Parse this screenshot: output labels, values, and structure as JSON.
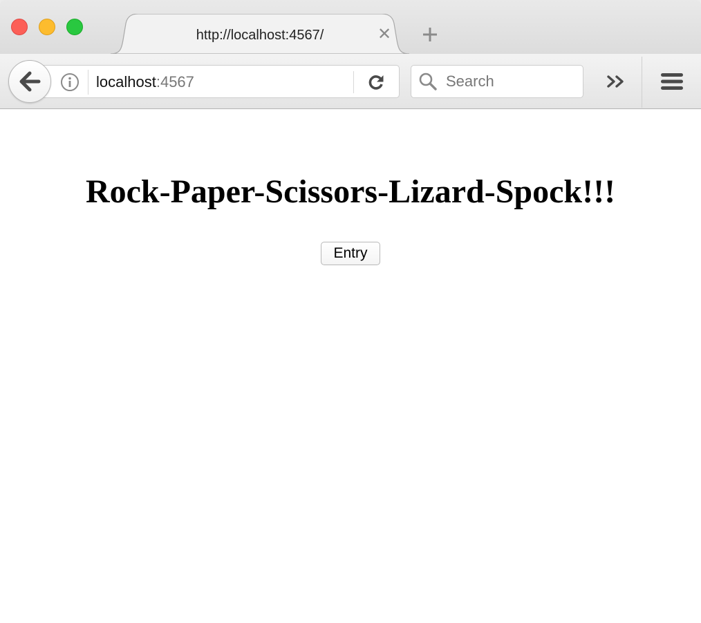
{
  "browser": {
    "tab": {
      "title": "http://localhost:4567/",
      "close_glyph": "✕"
    },
    "address_bar": {
      "host": "localhost",
      "port": ":4567"
    },
    "search": {
      "placeholder": "Search"
    },
    "icons": [
      "back-arrow-icon",
      "info-icon",
      "reload-icon",
      "search-icon",
      "overflow-chevrons-icon",
      "hamburger-menu-icon",
      "new-tab-plus-icon"
    ],
    "traffic_lights": {
      "close": "#fc5f57",
      "minimize": "#fdbc2e",
      "maximize": "#29c840"
    }
  },
  "page": {
    "heading": "Rock-Paper-Scissors-Lizard-Spock!!!",
    "entry_button_label": "Entry"
  }
}
